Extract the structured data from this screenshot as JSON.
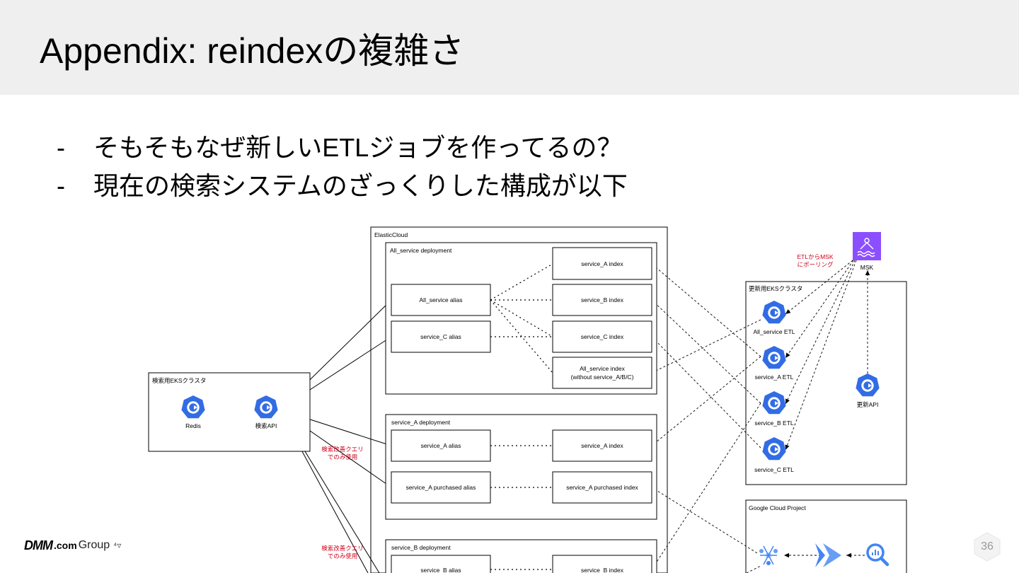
{
  "slide": {
    "title": "Appendix: reindexの複雑さ",
    "bullets": [
      "そもそもなぜ新しいETLジョブを作ってるの？",
      "現在の検索システムのざっくりした構成が以下"
    ],
    "page_number": "36"
  },
  "footer": {
    "logo_dmm": "DMM",
    "logo_com": ".com",
    "logo_group": "Group",
    "logo_mark": "⁴▿"
  },
  "diagram": {
    "search_cluster": {
      "label": "検索用EKSクラスタ",
      "redis": "Redis",
      "search_api": "検索API"
    },
    "elastic_cloud": {
      "label": "ElasticCloud",
      "all_service": {
        "label": "All_service deployment",
        "aliases": [
          "All_service alias",
          "service_C alias"
        ],
        "indexes": [
          "service_A index",
          "service_B index",
          "service_C index",
          "All_service index",
          "(without service_A/B/C)"
        ]
      },
      "service_a": {
        "label": "service_A deployment",
        "aliases": [
          "service_A alias",
          "service_A purchased alias"
        ],
        "indexes": [
          "service_A index",
          "service_A purchased index"
        ]
      },
      "service_b": {
        "label": "service_B deployment",
        "aliases": [
          "service_B alias"
        ],
        "indexes": [
          "service_B index"
        ]
      }
    },
    "notes": {
      "query_improve": [
        "検索改善クエリ",
        "でのみ使用"
      ],
      "etl_polling": [
        "ETLからMSK",
        "にポーリング"
      ]
    },
    "update_cluster": {
      "label": "更新用EKSクラスタ",
      "etls": [
        "All_service ETL",
        "service_A ETL",
        "service_B ETL",
        "service_C ETL"
      ],
      "update_api": "更新API"
    },
    "msk": "MSK",
    "gcp": {
      "label": "Google Cloud Project"
    },
    "colors": {
      "k8s_blue": "#326ce5",
      "msk_purple": "#8c4fff",
      "note_red": "#d0021b",
      "gcp_blue": "#4285f4",
      "header_bg": "#efefef"
    }
  }
}
